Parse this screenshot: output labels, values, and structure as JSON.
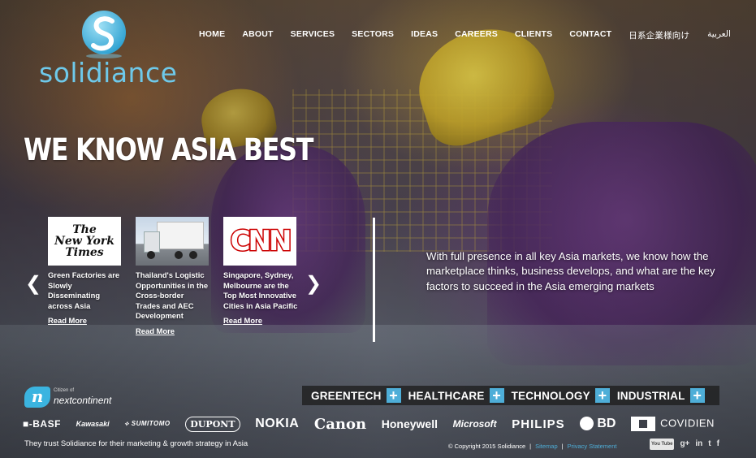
{
  "brand": {
    "name": "solidiance",
    "logo_letter": "S"
  },
  "nav": {
    "items": [
      "HOME",
      "ABOUT",
      "SERVICES",
      "SECTORS",
      "IDEAS",
      "CAREERS",
      "CLIENTS",
      "CONTACT",
      "日系企業様向け",
      "العربية"
    ]
  },
  "hero": {
    "title": "WE KNOW ASIA BEST",
    "tagline": "With full presence in all key Asia markets, we know how the marketplace thinks, business develops, and what are the key factors to succeed in the Asia emerging markets"
  },
  "carousel": {
    "prev": "❮",
    "next": "❯",
    "items": [
      {
        "source": "The New York Times",
        "source_lines": [
          "The",
          "New York",
          "Times"
        ],
        "caption": "Green Factories are Slowly Disseminating across Asia",
        "link": "Read More"
      },
      {
        "source": "truck photo",
        "caption": "Thailand's Logistic Opportunities in the Cross-border Trades and AEC Development",
        "link": "Read More"
      },
      {
        "source": "CNN",
        "caption": "Singapore, Sydney, Melbourne are the Top Most Innovative Cities in Asia Pacific",
        "link": "Read More"
      }
    ]
  },
  "nextcontinent": {
    "badge": "n",
    "small": "Citizen of",
    "name": "nextcontinent"
  },
  "sectors": [
    {
      "label": "GREENTECH",
      "icon": "+"
    },
    {
      "label": "HEALTHCARE",
      "icon": "+"
    },
    {
      "label": "TECHNOLOGY",
      "icon": "+"
    },
    {
      "label": "INDUSTRIAL",
      "icon": "+"
    }
  ],
  "clients": [
    "BASF",
    "Kawasaki",
    "SUMITOMO",
    "DUPONT",
    "NOKIA",
    "Canon",
    "Honeywell",
    "Microsoft",
    "PHILIPS",
    "BD",
    "COVIDIEN"
  ],
  "footer": {
    "trust": "They trust Solidiance for their marketing & growth strategy in Asia",
    "copyright": "© Copyright 2015 Solidiance",
    "sep1": "|",
    "link1": "Sitemap",
    "sep2": "|",
    "link2": "Privacy Statement",
    "social": [
      "You Tube",
      "g+",
      "in",
      "t",
      "f"
    ]
  },
  "colors": {
    "accent": "#4eaed8",
    "logo": "#6ec9ea"
  }
}
